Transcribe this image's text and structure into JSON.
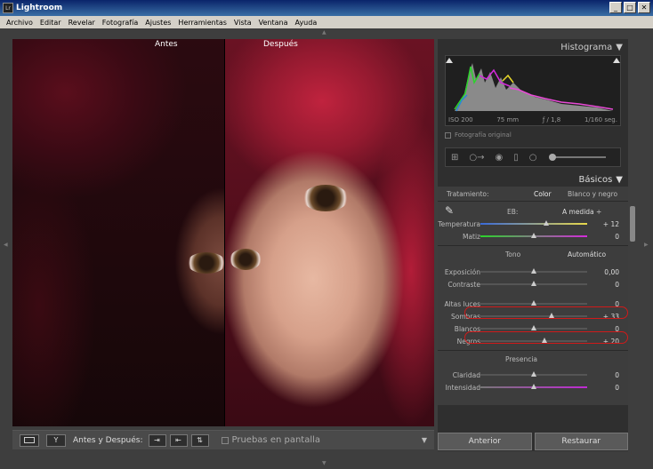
{
  "window": {
    "title": "Lightroom",
    "icon_text": "Lr",
    "minimize": "_",
    "maximize": "□",
    "close": "✕"
  },
  "menu": [
    "Archivo",
    "Editar",
    "Revelar",
    "Fotografía",
    "Ajustes",
    "Herramientas",
    "Vista",
    "Ventana",
    "Ayuda"
  ],
  "view": {
    "before_label": "Antes",
    "after_label": "Después"
  },
  "toolbar": {
    "before_after_label": "Antes y Después:",
    "proof_label": "Pruebas en pantalla",
    "dropdown": "▼"
  },
  "histogram": {
    "title": "Histograma",
    "iso": "ISO 200",
    "focal": "75 mm",
    "aperture": "ƒ / 1,8",
    "shutter": "1/160 seg.",
    "original_photo": "Fotografía original"
  },
  "basic": {
    "title": "Básicos",
    "treatment_label": "Tratamiento:",
    "treatment_color": "Color",
    "treatment_bw": "Blanco y negro",
    "wb_label": "EB:",
    "wb_value": "A medida ÷",
    "tone_label": "Tono",
    "auto_label": "Automático",
    "presence_label": "Presencia",
    "sliders": [
      {
        "label": "Temperatura",
        "value": "+ 12",
        "pos": 0.62
      },
      {
        "label": "Matiz",
        "value": "0",
        "pos": 0.5
      },
      {
        "label": "Exposición",
        "value": "0,00",
        "pos": 0.5
      },
      {
        "label": "Contraste",
        "value": "0",
        "pos": 0.5
      },
      {
        "label": "Altas luces",
        "value": "0",
        "pos": 0.5
      },
      {
        "label": "Sombras",
        "value": "+ 33",
        "pos": 0.67
      },
      {
        "label": "Blancos",
        "value": "0",
        "pos": 0.5
      },
      {
        "label": "Negros",
        "value": "+ 20",
        "pos": 0.6
      },
      {
        "label": "Claridad",
        "value": "0",
        "pos": 0.5
      },
      {
        "label": "Intensidad",
        "value": "0",
        "pos": 0.5
      }
    ]
  },
  "buttons": {
    "previous": "Anterior",
    "reset": "Restaurar"
  }
}
